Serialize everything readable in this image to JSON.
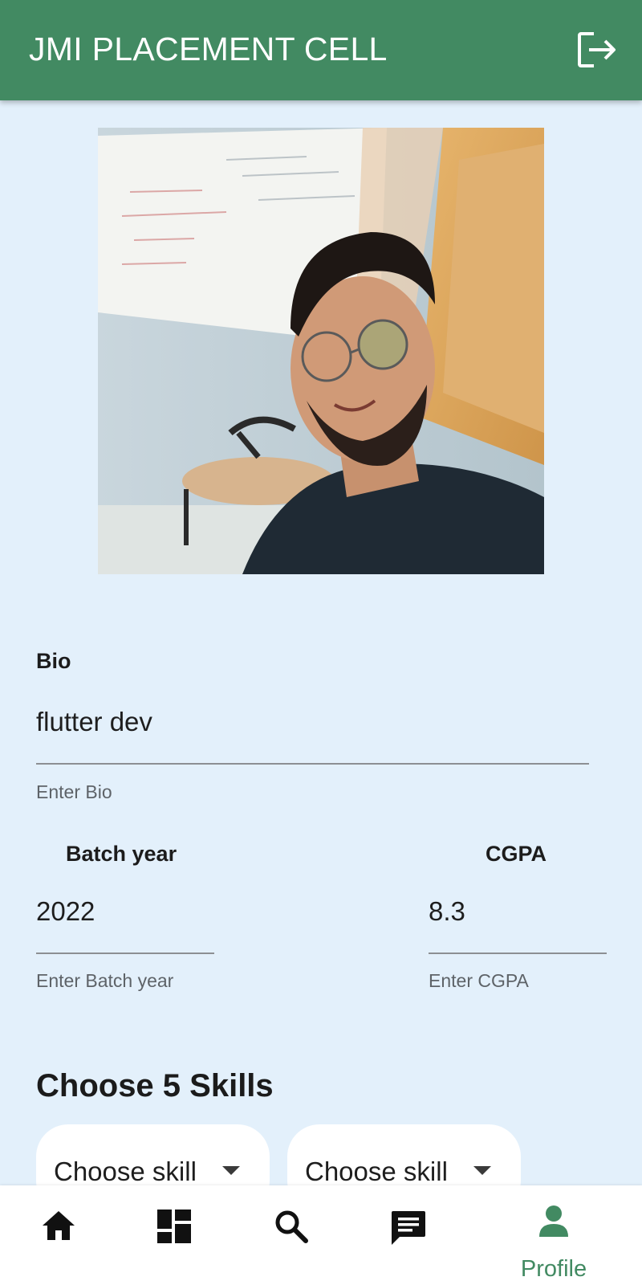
{
  "appbar": {
    "title": "JMI PLACEMENT CELL",
    "logout_icon": "logout-icon"
  },
  "profile": {
    "photo_alt": "profile-photo"
  },
  "bio": {
    "label": "Bio",
    "value": "flutter dev",
    "helper": "Enter Bio"
  },
  "batch": {
    "label": "Batch year",
    "value": "2022",
    "helper": "Enter Batch year"
  },
  "cgpa": {
    "label": "CGPA",
    "value": "8.3",
    "helper": "Enter CGPA"
  },
  "skills": {
    "title": "Choose 5 Skills",
    "chips": [
      {
        "label": "Choose skill"
      },
      {
        "label": "Choose skill"
      }
    ]
  },
  "nav": {
    "items": [
      {
        "icon": "home-icon"
      },
      {
        "icon": "dashboard-icon"
      },
      {
        "icon": "search-icon"
      },
      {
        "icon": "chat-icon"
      },
      {
        "icon": "person-icon",
        "label": "Profile",
        "active": true
      }
    ]
  },
  "colors": {
    "primary": "#428a62",
    "background": "#e3f0fb",
    "surface": "#ffffff"
  }
}
